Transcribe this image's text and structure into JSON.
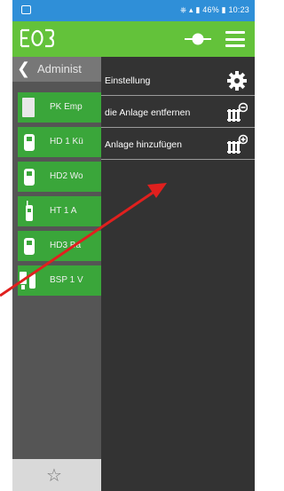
{
  "status_bar": {
    "right_text": "⎈ ▴ ▮ 46% ▮ 10:23"
  },
  "header": {
    "logo": "logo-icon",
    "connect_icon": "connect-icon",
    "menu_icon": "hamburger-menu-icon"
  },
  "left_panel": {
    "back_label": "❮",
    "title": "Administ",
    "devices": [
      {
        "label": "PK Emp",
        "icon": "panel-heater-icon"
      },
      {
        "label": "HD 1 Kü",
        "icon": "radiator-thermostat-icon"
      },
      {
        "label": "HD2 Wo",
        "icon": "radiator-thermostat-icon"
      },
      {
        "label": "HT 1 A",
        "icon": "room-thermostat-icon"
      },
      {
        "label": "HD3 Ba",
        "icon": "radiator-thermostat-icon"
      },
      {
        "label": "BSP 1 V",
        "icon": "smart-plug-icon"
      }
    ],
    "favorites_icon": "star-icon",
    "favorites_glyph": "☆"
  },
  "drawer": {
    "items": [
      {
        "label": "Einstellung",
        "icon": "gear-icon"
      },
      {
        "label": "die Anlage entfernen",
        "icon": "remove-system-icon"
      },
      {
        "label": "Anlage hinzufügen",
        "icon": "add-system-icon"
      }
    ]
  },
  "colors": {
    "header_green": "#63c23a",
    "device_green": "#3aa63a",
    "status_blue": "#2f8fd8",
    "drawer_bg": "#333333",
    "arrow_red": "#e0201e"
  }
}
